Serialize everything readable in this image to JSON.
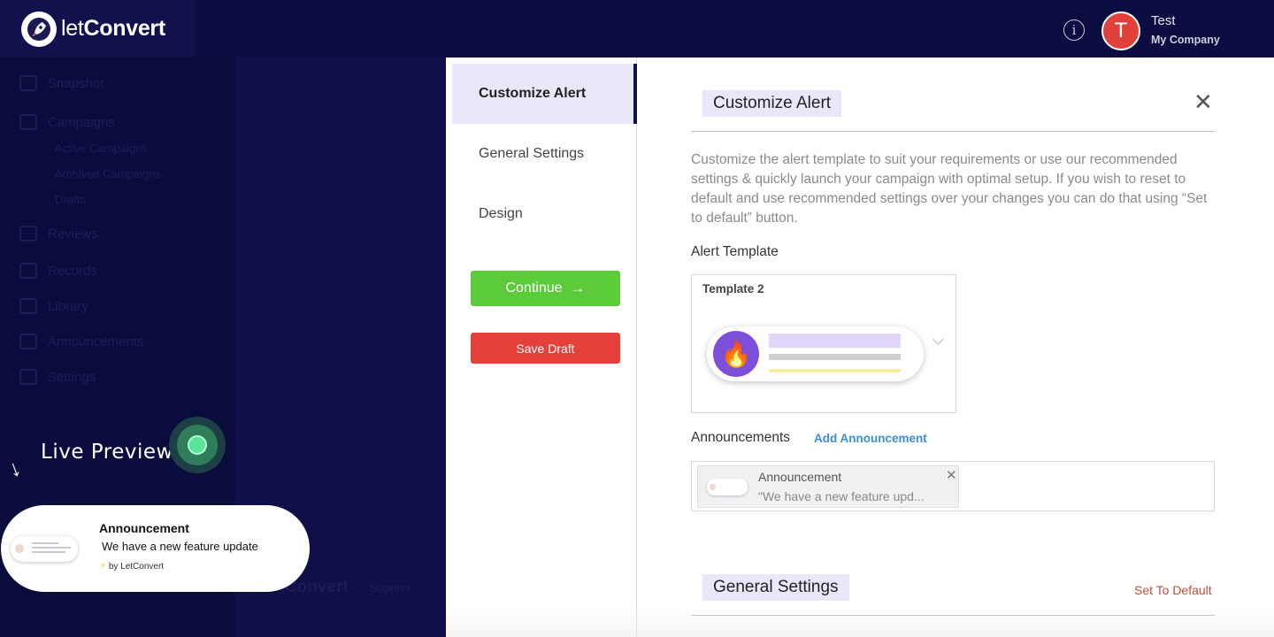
{
  "header": {
    "logo_prefix": "let",
    "logo_suffix": "Convert",
    "info_icon": "info-icon",
    "user": {
      "initial": "T",
      "name": "Test",
      "company": "My Company"
    },
    "colors": {
      "topbar": "#0b0c3f",
      "avatar": "#e0413a"
    }
  },
  "sidebar": {
    "items": [
      {
        "label": "Snapshot",
        "icon": "snapshot-icon"
      },
      {
        "label": "Campaigns",
        "icon": "rocket-icon"
      },
      {
        "label": "Reviews",
        "icon": "reviews-icon"
      },
      {
        "label": "Records",
        "icon": "records-icon"
      },
      {
        "label": "Library",
        "icon": "library-icon"
      },
      {
        "label": "Announcements",
        "icon": "megaphone-icon"
      },
      {
        "label": "Settings",
        "icon": "gear-icon"
      }
    ],
    "campaign_subitems": [
      "Active Campaigns",
      "Archived Campaigns",
      "Drafts"
    ],
    "footer": {
      "brand": "Convert",
      "link": "Support"
    }
  },
  "live_preview": {
    "label": "Live Preview",
    "card": {
      "title": "Announcement",
      "text": "We have a new feature update",
      "powered_by": "by LetConvert"
    }
  },
  "modal": {
    "nav": [
      {
        "label": "Customize Alert",
        "active": true
      },
      {
        "label": "General Settings",
        "active": false
      },
      {
        "label": "Design",
        "active": false
      }
    ],
    "continue_label": "Continue",
    "save_draft_label": "Save Draft",
    "title": "Customize Alert",
    "description": "Customize the alert template to suit your requirements or use our recommended settings & quickly launch your campaign with optimal setup. If you wish to reset to default and use recommended settings over your changes you can do that using “Set to default” button.",
    "alert_template_label": "Alert Template",
    "template": {
      "name": "Template 2"
    },
    "announcements_label": "Announcements",
    "add_announcement_label": "Add Announcement",
    "announcement_chip": {
      "title": "Announcement",
      "text": "\"We have a new feature upd..."
    },
    "general_settings_title": "General Settings",
    "set_to_default_label": "Set To Default",
    "colors": {
      "accent_bg": "#e9e8fb",
      "continue": "#5ccb3a",
      "save_draft": "#e5403a",
      "link": "#3a8fd6"
    }
  }
}
